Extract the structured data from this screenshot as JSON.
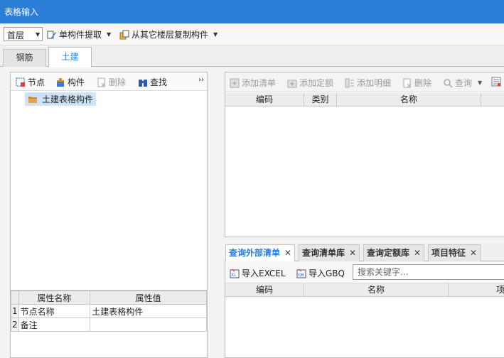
{
  "window": {
    "title": "表格输入"
  },
  "toolbar": {
    "floor_value": "首层",
    "extract_label": "单构件提取",
    "copy_label": "从其它楼层复制构件"
  },
  "tabs": [
    {
      "label": "钢筋"
    },
    {
      "label": "土建"
    }
  ],
  "left_toolbar": {
    "node": "节点",
    "component": "构件",
    "delete": "删除",
    "find": "查找",
    "overflow": "››"
  },
  "tree": {
    "root": "土建表格构件"
  },
  "property_grid": {
    "headers": [
      "属性名称",
      "属性值"
    ],
    "rows": [
      {
        "index": "1",
        "name": "节点名称",
        "value": "土建表格构件"
      },
      {
        "index": "2",
        "name": "备注",
        "value": ""
      }
    ]
  },
  "right_toolbar": {
    "add_bill": "添加清单",
    "add_quota": "添加定额",
    "add_detail": "添加明细",
    "delete": "删除",
    "query": "查询"
  },
  "right_table": {
    "headers": [
      "编码",
      "类别",
      "名称"
    ]
  },
  "bottom_tabs": [
    {
      "label": "查询外部清单"
    },
    {
      "label": "查询清单库"
    },
    {
      "label": "查询定额库"
    },
    {
      "label": "项目特征"
    }
  ],
  "bottom_toolbar": {
    "import_excel": "导入EXCEL",
    "import_gbq": "导入GBQ",
    "search_placeholder": "搜索关键字..."
  },
  "bottom_table": {
    "headers": [
      "编码",
      "名称",
      "项"
    ]
  },
  "colors": {
    "accent": "#2b7fd8",
    "selection": "#cfe3f6"
  }
}
